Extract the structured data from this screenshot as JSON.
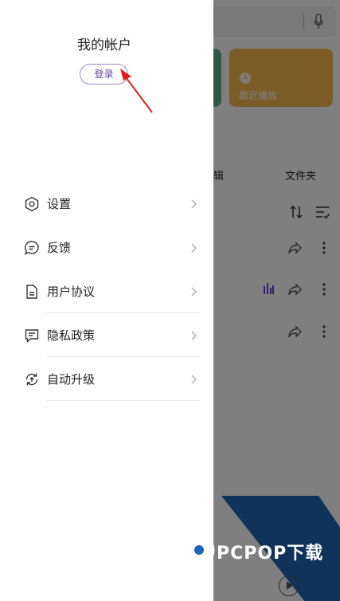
{
  "background_app": {
    "recent_card_label": "最近播放",
    "tab_partial_label": "辑",
    "tab_folder_label": "文件夹"
  },
  "drawer": {
    "account_title": "我的帐户",
    "login_label": "登录",
    "menu": [
      {
        "label": "设置",
        "icon": "hexagon-settings-icon"
      },
      {
        "label": "反馈",
        "icon": "chat-bubble-icon"
      },
      {
        "label": "用户协议",
        "icon": "document-icon"
      },
      {
        "label": "隐私政策",
        "icon": "message-square-icon"
      },
      {
        "label": "自动升级",
        "icon": "refresh-upgrade-icon"
      }
    ]
  },
  "watermark": {
    "text": "PCPOP下载"
  },
  "colors": {
    "overlay": "rgba(0,0,0,0.5)",
    "accent_purple": "#5d4a9c",
    "annotation_red": "#e02020",
    "card_green": "#5cb389",
    "card_orange": "#f6b94f",
    "brand_blue": "#1e66b3"
  }
}
